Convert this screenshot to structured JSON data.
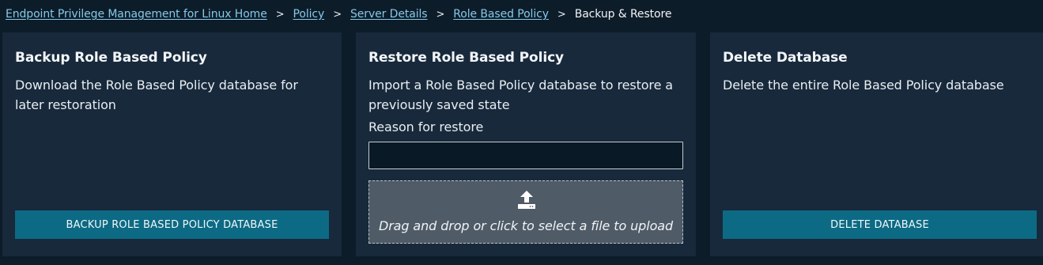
{
  "breadcrumb": {
    "items": [
      {
        "label": "Endpoint Privilege Management for Linux Home"
      },
      {
        "label": "Policy"
      },
      {
        "label": "Server Details"
      },
      {
        "label": "Role Based Policy"
      }
    ],
    "separator": ">",
    "current": "Backup & Restore"
  },
  "backup_card": {
    "title": "Backup Role Based Policy",
    "description": "Download the Role Based Policy database for later restoration",
    "button_label": "BACKUP ROLE BASED POLICY DATABASE"
  },
  "restore_card": {
    "title": "Restore Role Based Policy",
    "description": "Import a Role Based Policy database to restore a previously saved state",
    "reason_label": "Reason for restore",
    "reason_value": "",
    "dropzone_icon": "upload-icon",
    "dropzone_text": "Drag and drop or click to select a file to upload"
  },
  "delete_card": {
    "title": "Delete Database",
    "description": "Delete the entire Role Based Policy database",
    "button_label": "DELETE DATABASE"
  },
  "colors": {
    "page_background": "#0d1c29",
    "card_background": "#18293b",
    "link": "#86c9e8",
    "button": "#0c6a84",
    "dropzone": "#4f5b67"
  }
}
